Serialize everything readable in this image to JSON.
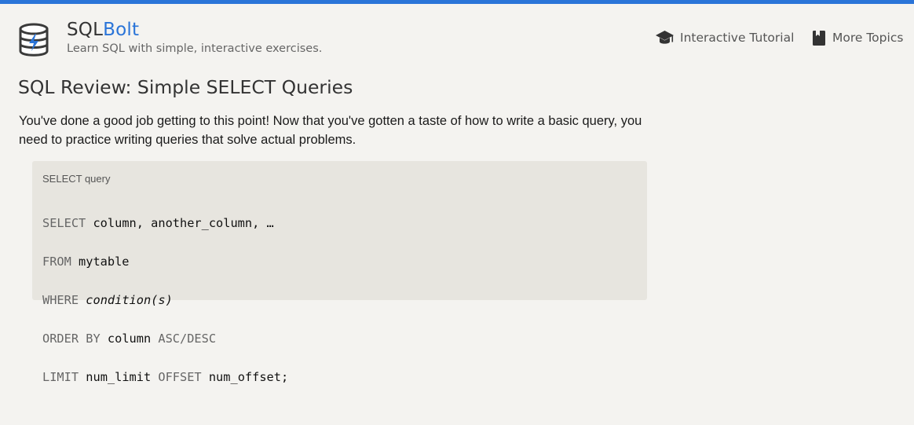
{
  "header": {
    "brand_prefix": "SQL",
    "brand_suffix": "Bolt",
    "tagline": "Learn SQL with simple, interactive exercises.",
    "logo_icon": "database-bolt-icon",
    "accent_color": "#2a74d8"
  },
  "nav": {
    "tutorial": {
      "label": "Interactive Tutorial",
      "icon": "graduation-cap-icon"
    },
    "topics": {
      "label": "More Topics",
      "icon": "book-icon"
    }
  },
  "main": {
    "title": "SQL Review: Simple SELECT Queries",
    "intro": "You've done a good job getting to this point! Now that you've gotten a taste of how to write a basic query, you need to practice writing queries that solve actual problems."
  },
  "code_block": {
    "caption": "SELECT query",
    "lines": [
      {
        "keyword": "SELECT",
        "text": " column, another_column, …"
      },
      {
        "keyword": "FROM",
        "text": " mytable"
      },
      {
        "keyword": "WHERE",
        "text": "condition(s)"
      },
      {
        "keyword": "ORDER BY",
        "text": " column ",
        "keyword2": "ASC/DESC"
      },
      {
        "keyword": "LIMIT",
        "text": " num_limit ",
        "keyword2": "OFFSET",
        "text2": " num_offset;"
      }
    ]
  }
}
